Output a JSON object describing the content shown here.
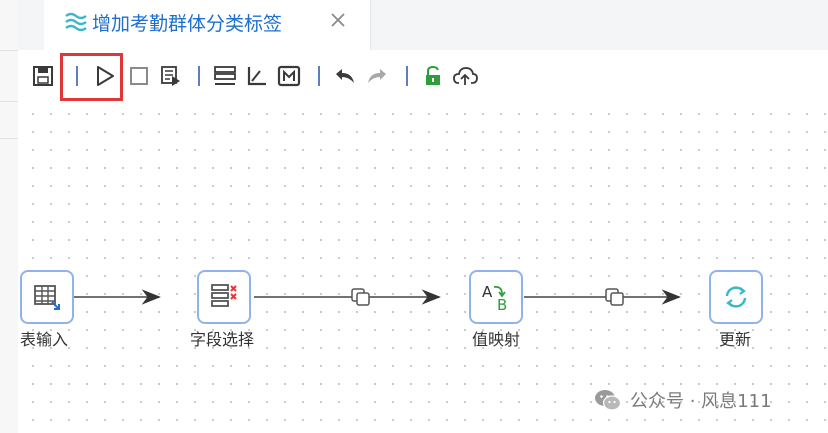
{
  "tab": {
    "title": "增加考勤群体分类标签"
  },
  "toolbar": {
    "buttons": [
      "save-icon",
      "run-icon",
      "stop-icon",
      "preview-icon",
      "align-icon",
      "axis-icon",
      "metrics-icon",
      "undo-icon",
      "redo-icon",
      "unlock-icon",
      "upload-icon"
    ],
    "highlighted": "run-button"
  },
  "flow": {
    "nodes": [
      {
        "label": "表输入",
        "icon": "table-input-icon"
      },
      {
        "label": "字段选择",
        "icon": "field-select-icon"
      },
      {
        "label": "值映射",
        "icon": "value-map-icon",
        "glyph_a": "A",
        "glyph_b": "B"
      },
      {
        "label": "更新",
        "icon": "refresh-icon"
      }
    ]
  },
  "watermark": {
    "text": "公众号 · 风息111"
  },
  "colors": {
    "accent": "#1f6fce",
    "node_border": "#8fb3ec",
    "highlight": "#e2373a",
    "green": "#2e9d3c"
  }
}
